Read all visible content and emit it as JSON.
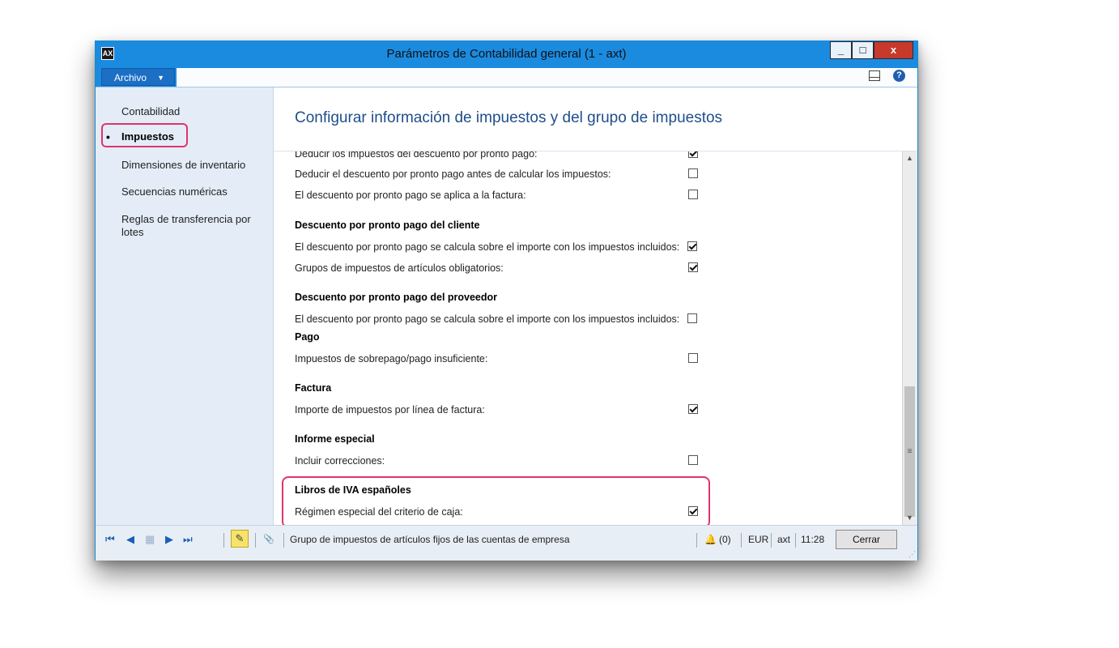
{
  "window": {
    "title": "Parámetros de Contabilidad general (1 - axt)",
    "app_icon": "ax-icon",
    "controls": {
      "minimize": "_",
      "maximize": "□",
      "close": "x"
    }
  },
  "menubar": {
    "file_label": "Archivo",
    "file_arrow": "▼",
    "layout_icon": "layout-icon",
    "help_icon": "?"
  },
  "nav": {
    "items": [
      {
        "label": "Contabilidad",
        "active": false
      },
      {
        "label": "Impuestos",
        "active": true
      },
      {
        "label": "Dimensiones de inventario",
        "active": false
      },
      {
        "label": "Secuencias numéricas",
        "active": false
      },
      {
        "label": "Reglas de transferencia por lotes",
        "active": false
      }
    ],
    "bullet": "•"
  },
  "content": {
    "heading": "Configurar información de impuestos y del grupo de impuestos",
    "rows": [
      {
        "type": "field",
        "label": "Deducir los impuestos del descuento por pronto pago:",
        "checked": true
      },
      {
        "type": "field",
        "label": "Deducir el descuento por pronto pago antes de calcular los impuestos:",
        "checked": false
      },
      {
        "type": "field",
        "label": "El descuento por pronto pago se aplica a la factura:",
        "checked": false
      },
      {
        "type": "section",
        "label": "Descuento por pronto pago del cliente"
      },
      {
        "type": "field",
        "label": "El descuento por pronto pago se calcula sobre el importe con los impuestos incluidos:",
        "checked": true
      },
      {
        "type": "field",
        "label": "Grupos de impuestos de artículos obligatorios:",
        "checked": true
      },
      {
        "type": "section",
        "label": "Descuento por pronto pago del proveedor"
      },
      {
        "type": "field",
        "label": "El descuento por pronto pago se calcula sobre el importe con los impuestos incluidos:",
        "checked": false
      },
      {
        "type": "section",
        "label": "Pago"
      },
      {
        "type": "field",
        "label": "Impuestos de sobrepago/pago insuficiente:",
        "checked": false
      },
      {
        "type": "section",
        "label": "Factura"
      },
      {
        "type": "field",
        "label": "Importe de impuestos por línea de factura:",
        "checked": true
      },
      {
        "type": "section",
        "label": "Informe especial"
      },
      {
        "type": "field",
        "label": "Incluir correcciones:",
        "checked": false
      },
      {
        "type": "section",
        "label": "Libros de IVA españoles"
      },
      {
        "type": "field",
        "label": "Régimen especial del criterio de caja:",
        "checked": true
      }
    ]
  },
  "statusbar": {
    "nav_first": "⏮",
    "nav_prev": "◀",
    "nav_grid": "▦",
    "nav_next": "▶",
    "nav_last": "⏭",
    "edit_icon": "✎",
    "attach_icon": "📎",
    "help_text": "Grupo de impuestos de artículos fijos de las cuentas de empresa",
    "notifications": "(0)",
    "currency": "EUR",
    "company": "axt",
    "time": "11:28",
    "close_label": "Cerrar"
  }
}
